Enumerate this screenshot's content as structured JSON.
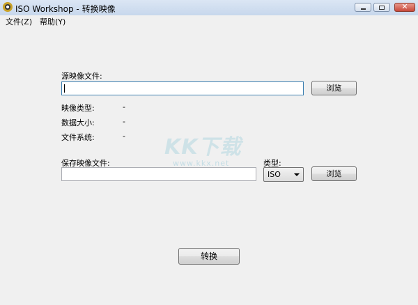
{
  "window": {
    "title": "ISO Workshop - 转换映像",
    "controls": {
      "minimize_icon": "minimize-icon",
      "maximize_icon": "maximize-icon",
      "close_icon": "close-icon",
      "close_glyph": "✕"
    }
  },
  "menu": {
    "items": [
      "文件(Z)",
      "帮助(Y)"
    ]
  },
  "source": {
    "label": "源映像文件:",
    "value": "",
    "browse_label": "浏览"
  },
  "info": {
    "image_type_label": "映像类型:",
    "image_type_value": "-",
    "data_size_label": "数据大小:",
    "data_size_value": "-",
    "filesystem_label": "文件系统:",
    "filesystem_value": "-"
  },
  "save": {
    "label": "保存映像文件:",
    "value": "",
    "type_label": "类型:",
    "type_selected": "ISO",
    "browse_label": "浏览"
  },
  "convert_label": "转换",
  "watermark": {
    "main": "KK下载",
    "sub": "www.kkx.net"
  },
  "colors": {
    "titlebar": "#c7d7ec",
    "close_button": "#c8483a",
    "background": "#f0f0f0"
  }
}
